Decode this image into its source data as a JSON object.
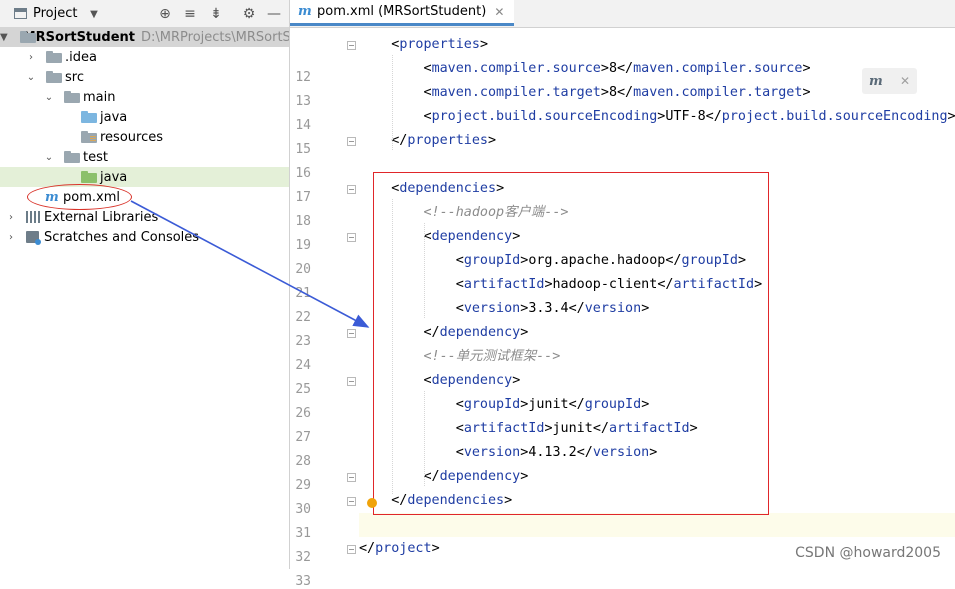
{
  "project_panel": {
    "title": "Project",
    "tree": [
      {
        "label": "MRSortStudent",
        "path": "D:\\MRProjects\\MRSortStudent"
      },
      {
        "label": ".idea"
      },
      {
        "label": "src"
      },
      {
        "label": "main"
      },
      {
        "label": "java"
      },
      {
        "label": "resources"
      },
      {
        "label": "test"
      },
      {
        "label": "java"
      },
      {
        "label": "pom.xml"
      },
      {
        "label": "External Libraries"
      },
      {
        "label": "Scratches and Consoles"
      }
    ]
  },
  "editor": {
    "tab_label": "pom.xml (MRSortStudent)",
    "lines": [
      {
        "n": "12",
        "text": "    <properties>"
      },
      {
        "n": "13",
        "text": "        <maven.compiler.source>8</maven.compiler.source>"
      },
      {
        "n": "14",
        "text": "        <maven.compiler.target>8</maven.compiler.target>"
      },
      {
        "n": "15",
        "text": "        <project.build.sourceEncoding>UTF-8</project.build.sourceEncoding>"
      },
      {
        "n": "16",
        "text": "    </properties>"
      },
      {
        "n": "17",
        "text": ""
      },
      {
        "n": "18",
        "text": "    <dependencies>"
      },
      {
        "n": "19",
        "text": "        <!--hadoop客户端-->"
      },
      {
        "n": "20",
        "text": "        <dependency>"
      },
      {
        "n": "21",
        "text": "            <groupId>org.apache.hadoop</groupId>"
      },
      {
        "n": "22",
        "text": "            <artifactId>hadoop-client</artifactId>"
      },
      {
        "n": "23",
        "text": "            <version>3.3.4</version>"
      },
      {
        "n": "24",
        "text": "        </dependency>"
      },
      {
        "n": "25",
        "text": "        <!--单元测试框架-->"
      },
      {
        "n": "26",
        "text": "        <dependency>"
      },
      {
        "n": "27",
        "text": "            <groupId>junit</groupId>"
      },
      {
        "n": "28",
        "text": "            <artifactId>junit</artifactId>"
      },
      {
        "n": "29",
        "text": "            <version>4.13.2</version>"
      },
      {
        "n": "30",
        "text": "        </dependency>"
      },
      {
        "n": "31",
        "text": "    </dependencies>"
      },
      {
        "n": "32",
        "text": ""
      },
      {
        "n": "33",
        "text": "</project>"
      }
    ]
  },
  "watermark": "CSDN @howard2005",
  "colors": {
    "tag": "#1f3da3",
    "comment": "#8c8c8c",
    "annotation": "#e0262a",
    "arrow": "#3b5bd6"
  }
}
